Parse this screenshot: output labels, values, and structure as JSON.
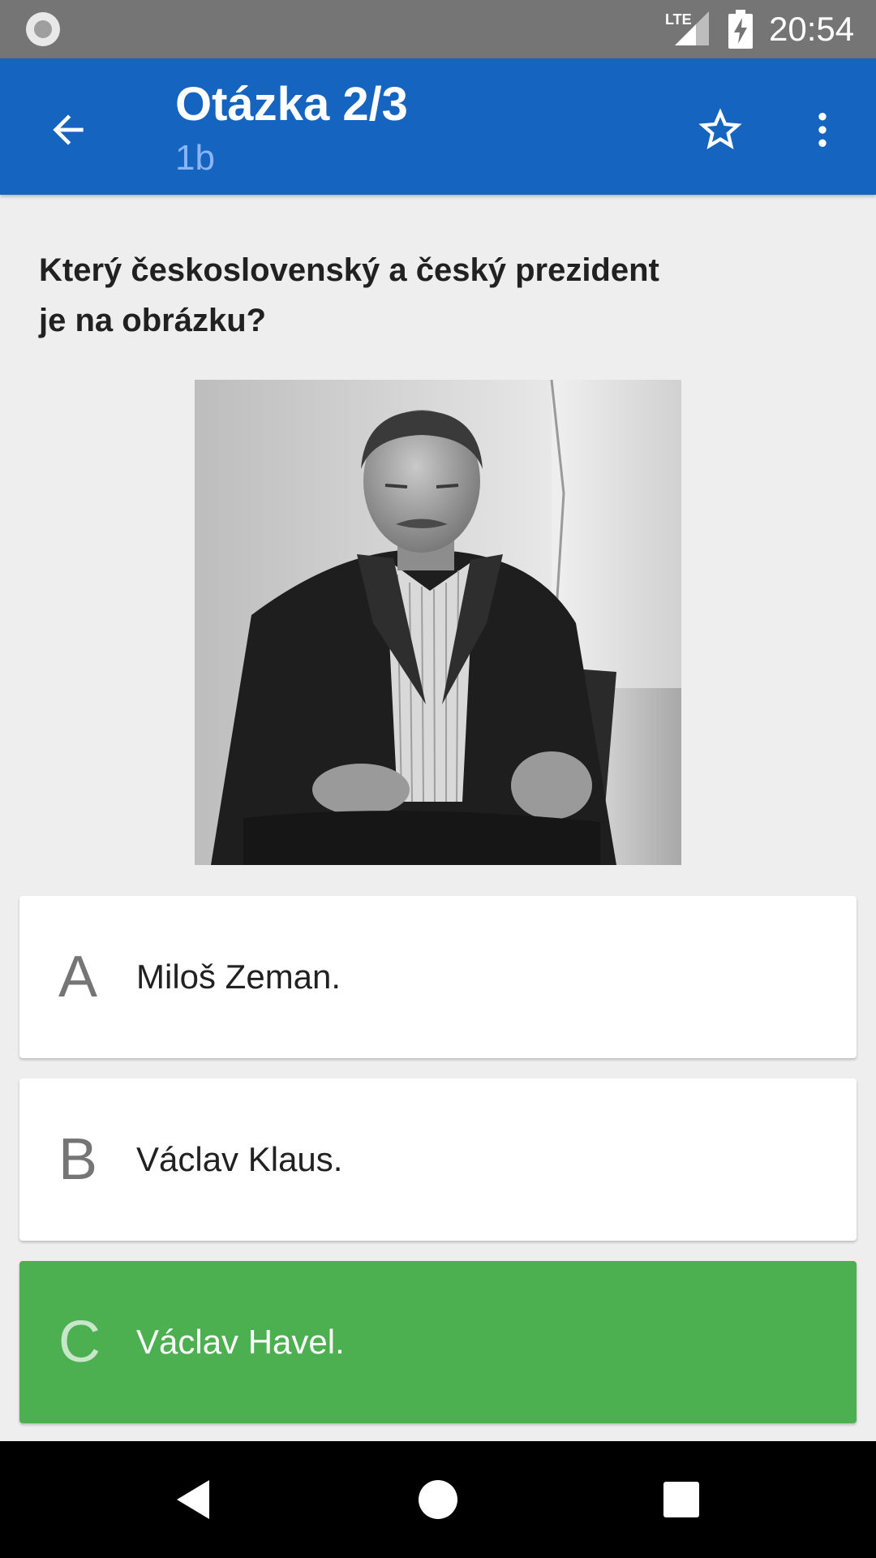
{
  "status_bar": {
    "time": "20:54",
    "network_label": "LTE",
    "icons": [
      "notification-dot-icon",
      "lte-signal-icon",
      "battery-charging-icon"
    ]
  },
  "app_bar": {
    "title": "Otázka 2/3",
    "subtitle": "1b",
    "icons": [
      "arrow-back-icon",
      "star-outline-icon",
      "more-vert-icon"
    ],
    "color": "#1565c0"
  },
  "question": {
    "text": "Který československý a český prezident je na obrázku?"
  },
  "answers": [
    {
      "letter": "A",
      "text": "Miloš Zeman.",
      "state": "default"
    },
    {
      "letter": "B",
      "text": "Václav Klaus.",
      "state": "default"
    },
    {
      "letter": "C",
      "text": "Václav Havel.",
      "state": "correct"
    }
  ],
  "colors": {
    "correct": "#4caf50",
    "card": "#ffffff",
    "background": "#eeeeee"
  },
  "nav_bar": {
    "icons": [
      "nav-back-icon",
      "nav-home-icon",
      "nav-recents-icon"
    ]
  }
}
